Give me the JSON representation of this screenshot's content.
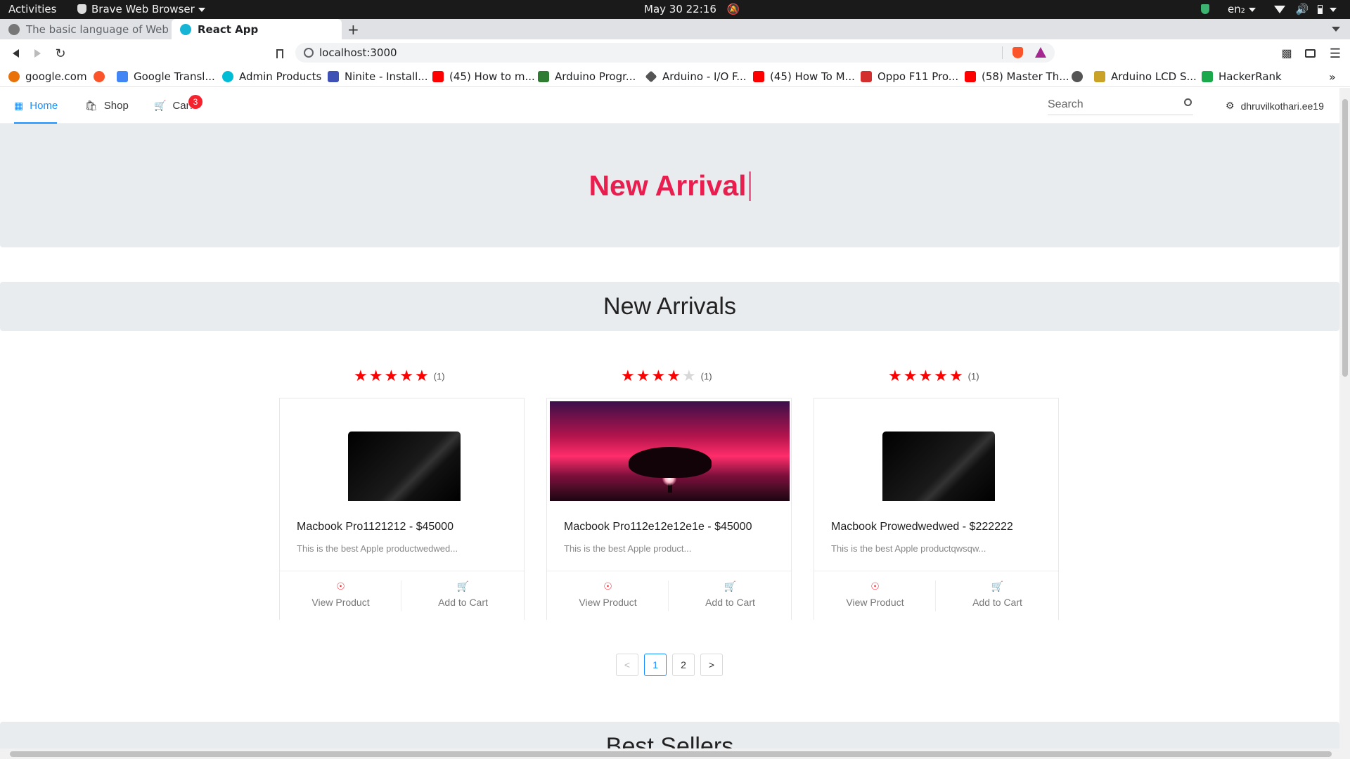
{
  "system_bar": {
    "activities": "Activities",
    "app_menu": "Brave Web Browser",
    "datetime": "May 30  22:16",
    "language": "en₂"
  },
  "tabs": [
    {
      "label": "The basic language of Web : h",
      "active": false
    },
    {
      "label": "React App",
      "active": true
    }
  ],
  "new_tab_label": "+",
  "address": {
    "url": "localhost:3000"
  },
  "bookmarks": [
    {
      "label": "google.com",
      "color": "#e8710a"
    },
    {
      "label": "Google Transl...",
      "color": "#4285f4"
    },
    {
      "label": "Admin Products",
      "color": "#00bcd4"
    },
    {
      "label": "Ninite - Install...",
      "color": "#3f51b5"
    },
    {
      "label": "(45) How to m...",
      "color": "#ff0000"
    },
    {
      "label": "Arduino Progr...",
      "color": "#2e7d32"
    },
    {
      "label": "Arduino - I/O F...",
      "color": "#555555"
    },
    {
      "label": "(45) How To M...",
      "color": "#ff0000"
    },
    {
      "label": "Oppo F11 Pro...",
      "color": "#d32f2f"
    },
    {
      "label": "(58) Master Th...",
      "color": "#ff0000"
    },
    {
      "label": "Arduino LCD S...",
      "color": "#c9a227"
    },
    {
      "label": "HackerRank",
      "color": "#1ba94c"
    }
  ],
  "app_nav": {
    "home": "Home",
    "shop": "Shop",
    "cart": "Cart",
    "cart_count": "3",
    "search_placeholder": "Search",
    "user": "dhruvilkothari.ee19"
  },
  "hero": {
    "text": "New Arrival"
  },
  "sections": {
    "new_arrivals": "New Arrivals",
    "best_sellers": "Best Sellers"
  },
  "products": [
    {
      "title": "Macbook Pro1121212 - $45000",
      "description": "This is the best Apple productwedwed...",
      "rating": 5,
      "rating_count": "(1)",
      "image": "laptop",
      "view_label": "View Product",
      "cart_label": "Add to Cart"
    },
    {
      "title": "Macbook Pro112e12e12e1e - $45000",
      "description": "This is the best Apple product...",
      "rating": 4,
      "rating_count": "(1)",
      "image": "sunset",
      "view_label": "View Product",
      "cart_label": "Add to Cart"
    },
    {
      "title": "Macbook Prowedwedwed - $222222",
      "description": "This is the best Apple productqwsqw...",
      "rating": 5,
      "rating_count": "(1)",
      "image": "laptop",
      "view_label": "View Product",
      "cart_label": "Add to Cart"
    }
  ],
  "pagination": {
    "pages": [
      "1",
      "2"
    ],
    "current": "1",
    "prev": "<",
    "next": ">"
  },
  "colors": {
    "accent": "#1890ff",
    "hero_text": "#e91e4f",
    "star": "#ff0000",
    "badge": "#f5222d"
  }
}
